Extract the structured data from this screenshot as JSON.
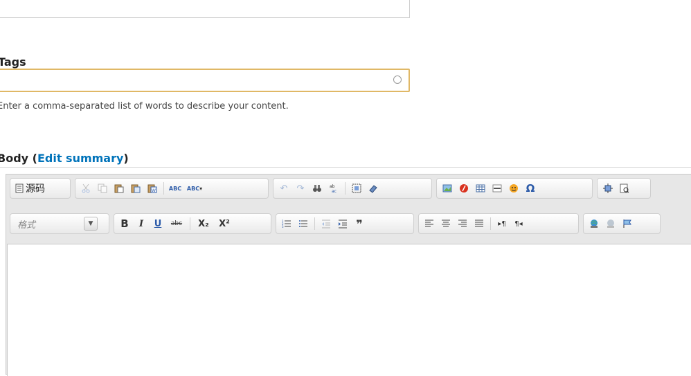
{
  "tags": {
    "label": "Tags",
    "description": "Enter a comma-separated list of words to describe your content."
  },
  "body": {
    "label": "Body (",
    "edit_summary": "Edit summary",
    "label_close": ")"
  },
  "toolbar": {
    "source_label": "源码",
    "format_placeholder": "格式",
    "bold": "B",
    "italic": "I",
    "underline": "U",
    "strike": "abc",
    "subscript": "X₂",
    "superscript": "X²",
    "spell_check": "ABC",
    "spell_check_as_you_type": "ABC",
    "blockquote": "❞",
    "special_char": "Ω"
  }
}
